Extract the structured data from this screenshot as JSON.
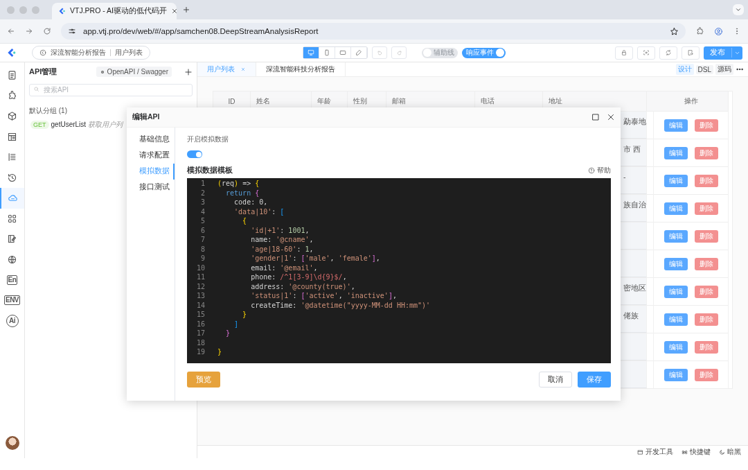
{
  "browser": {
    "tab_title": "VTJ.PRO - AI驱动的低代码开",
    "url": "app.vtj.pro/dev/web/#/app/samchen08.DeepStreamAnalysisReport"
  },
  "toolbar": {
    "breadcrumb": [
      "深流智能分析报告",
      "用户列表"
    ],
    "devices": [
      {
        "selected": true
      },
      {
        "selected": false
      },
      {
        "selected": false
      },
      {
        "selected": false
      }
    ],
    "toggles": [
      {
        "label": "辅助线",
        "on": false
      },
      {
        "label": "响应事件",
        "on": true
      }
    ],
    "publish": "发布"
  },
  "rail": [
    {
      "selected": false
    },
    {
      "selected": false
    },
    {
      "selected": false
    },
    {
      "selected": false
    },
    {
      "selected": false
    },
    {
      "selected": false
    },
    {
      "selected": true
    },
    {
      "selected": false
    },
    {
      "selected": false
    },
    {
      "selected": false
    },
    {
      "selected": false,
      "label": "En"
    },
    {
      "selected": false,
      "label": "ENV"
    },
    {
      "selected": false,
      "label": "Ai"
    }
  ],
  "api_panel": {
    "title": "API管理",
    "import_button": "OpenAPI / Swagger",
    "search": {
      "placeholder": "搜索API"
    },
    "groups": [
      {
        "name": "默认分组 (1)",
        "items": [
          {
            "method": "GET",
            "name": "getUserList",
            "description": "获取用户列"
          }
        ]
      }
    ]
  },
  "editor_tabs": [
    {
      "label": "用户列表",
      "selected": true,
      "closable": true
    },
    {
      "label": "深流智能科技分析报告",
      "selected": false,
      "closable": false
    }
  ],
  "view_modes": [
    {
      "label": "设计",
      "selected": true
    },
    {
      "label": "DSL",
      "selected": false
    },
    {
      "label": "源码",
      "selected": false
    }
  ],
  "table": {
    "columns": [
      "ID",
      "姓名",
      "年龄",
      "性别",
      "邮箱",
      "电话",
      "地址",
      "操作"
    ],
    "rows": [
      {
        "address": "勐泰地",
        "actions": [
          "编辑",
          "删除"
        ]
      },
      {
        "address": "市 西",
        "actions": [
          "编辑",
          "删除"
        ]
      },
      {
        "address": "-",
        "actions": [
          "编辑",
          "删除"
        ]
      },
      {
        "address": "族自治",
        "actions": [
          "编辑",
          "删除"
        ]
      },
      {
        "actions": [
          "编辑",
          "删除"
        ]
      },
      {
        "actions": [
          "编辑",
          "删除"
        ]
      },
      {
        "address": "密地区",
        "actions": [
          "编辑",
          "删除"
        ]
      },
      {
        "address": "佬族",
        "actions": [
          "编辑",
          "删除"
        ]
      },
      {
        "actions": [
          "编辑",
          "删除"
        ]
      },
      {
        "actions": [
          "编辑",
          "删除"
        ]
      }
    ]
  },
  "dialog": {
    "title": "编辑API",
    "nav": [
      {
        "label": "基础信息",
        "selected": false
      },
      {
        "label": "请求配置",
        "selected": false
      },
      {
        "label": "模拟数据",
        "selected": true
      },
      {
        "label": "接口测试",
        "selected": false
      }
    ],
    "mock_label": "开启模拟数据",
    "mock_enabled": true,
    "template_title": "模拟数据模板",
    "help": "帮助",
    "code": [
      {
        "number": "1",
        "tokens": [
          {
            "t": "(",
            "kind": "b1"
          },
          {
            "t": "req",
            "kind": "plain"
          },
          {
            "t": ")",
            "kind": "b1"
          },
          {
            "t": " =>",
            "kind": "plain"
          },
          {
            "t": " {",
            "kind": "b1"
          }
        ]
      },
      {
        "number": "2",
        "tokens": [
          {
            "t": "  return",
            "kind": "keyword"
          },
          {
            "t": " {",
            "kind": "b2"
          }
        ]
      },
      {
        "number": "3",
        "tokens": [
          {
            "t": "    code: 0,",
            "kind": "plain"
          }
        ]
      },
      {
        "number": "4",
        "tokens": [
          {
            "t": "    'data|10'",
            "kind": "string"
          },
          {
            "t": ":",
            "kind": "plain"
          },
          {
            "t": " [",
            "kind": "b3"
          }
        ]
      },
      {
        "number": "5",
        "tokens": [
          {
            "t": "      {",
            "kind": "b1"
          }
        ]
      },
      {
        "number": "6",
        "tokens": [
          {
            "t": "        'id|+1'",
            "kind": "string"
          },
          {
            "t": ":",
            "kind": "plain"
          },
          {
            "t": " 1001",
            "kind": "number"
          },
          {
            "t": ",",
            "kind": "plain"
          }
        ]
      },
      {
        "number": "7",
        "tokens": [
          {
            "t": "        name:",
            "kind": "plain"
          },
          {
            "t": " '@cname'",
            "kind": "string"
          },
          {
            "t": ",",
            "kind": "plain"
          }
        ]
      },
      {
        "number": "8",
        "tokens": [
          {
            "t": "        'age|18-60'",
            "kind": "string"
          },
          {
            "t": ":",
            "kind": "plain"
          },
          {
            "t": " 1",
            "kind": "number"
          },
          {
            "t": ",",
            "kind": "plain"
          }
        ]
      },
      {
        "number": "9",
        "tokens": [
          {
            "t": "        'gender|1'",
            "kind": "string"
          },
          {
            "t": ":",
            "kind": "plain"
          },
          {
            "t": " [",
            "kind": "b2"
          },
          {
            "t": "'male'",
            "kind": "string"
          },
          {
            "t": ",",
            "kind": "plain"
          },
          {
            "t": " 'female'",
            "kind": "string"
          },
          {
            "t": "]",
            "kind": "b2"
          },
          {
            "t": ",",
            "kind": "plain"
          }
        ]
      },
      {
        "number": "10",
        "tokens": [
          {
            "t": "        email:",
            "kind": "plain"
          },
          {
            "t": " '@email'",
            "kind": "string"
          },
          {
            "t": ",",
            "kind": "plain"
          }
        ]
      },
      {
        "number": "11",
        "tokens": [
          {
            "t": "        phone:",
            "kind": "plain"
          },
          {
            "t": " /^1[3-9]\\d{9}$/",
            "kind": "regex"
          },
          {
            "t": ",",
            "kind": "plain"
          }
        ]
      },
      {
        "number": "12",
        "tokens": [
          {
            "t": "        address:",
            "kind": "plain"
          },
          {
            "t": " '@county(true)'",
            "kind": "string"
          },
          {
            "t": ",",
            "kind": "plain"
          }
        ]
      },
      {
        "number": "13",
        "tokens": [
          {
            "t": "        'status|1'",
            "kind": "string"
          },
          {
            "t": ":",
            "kind": "plain"
          },
          {
            "t": " [",
            "kind": "b2"
          },
          {
            "t": "'active'",
            "kind": "string"
          },
          {
            "t": ",",
            "kind": "plain"
          },
          {
            "t": " 'inactive'",
            "kind": "string"
          },
          {
            "t": "]",
            "kind": "b2"
          },
          {
            "t": ",",
            "kind": "plain"
          }
        ]
      },
      {
        "number": "14",
        "tokens": [
          {
            "t": "        createTime:",
            "kind": "plain"
          },
          {
            "t": " '@datetime(\"yyyy-MM-dd HH:mm\")'",
            "kind": "string"
          }
        ]
      },
      {
        "number": "15",
        "tokens": [
          {
            "t": "      }",
            "kind": "b1"
          }
        ]
      },
      {
        "number": "16",
        "tokens": [
          {
            "t": "    ]",
            "kind": "b3"
          }
        ]
      },
      {
        "number": "17",
        "tokens": [
          {
            "t": "  }",
            "kind": "b2"
          }
        ]
      },
      {
        "number": "18"
      },
      {
        "number": "19",
        "tokens": [
          {
            "t": "}",
            "kind": "b1"
          }
        ]
      }
    ],
    "buttons": [
      {
        "label": "预览",
        "kind": "warning"
      },
      {
        "label": "取消",
        "kind": "default"
      },
      {
        "label": "保存",
        "kind": "primary"
      }
    ]
  },
  "status_bar": [
    "开发工具",
    "快捷键",
    "暗黑"
  ]
}
